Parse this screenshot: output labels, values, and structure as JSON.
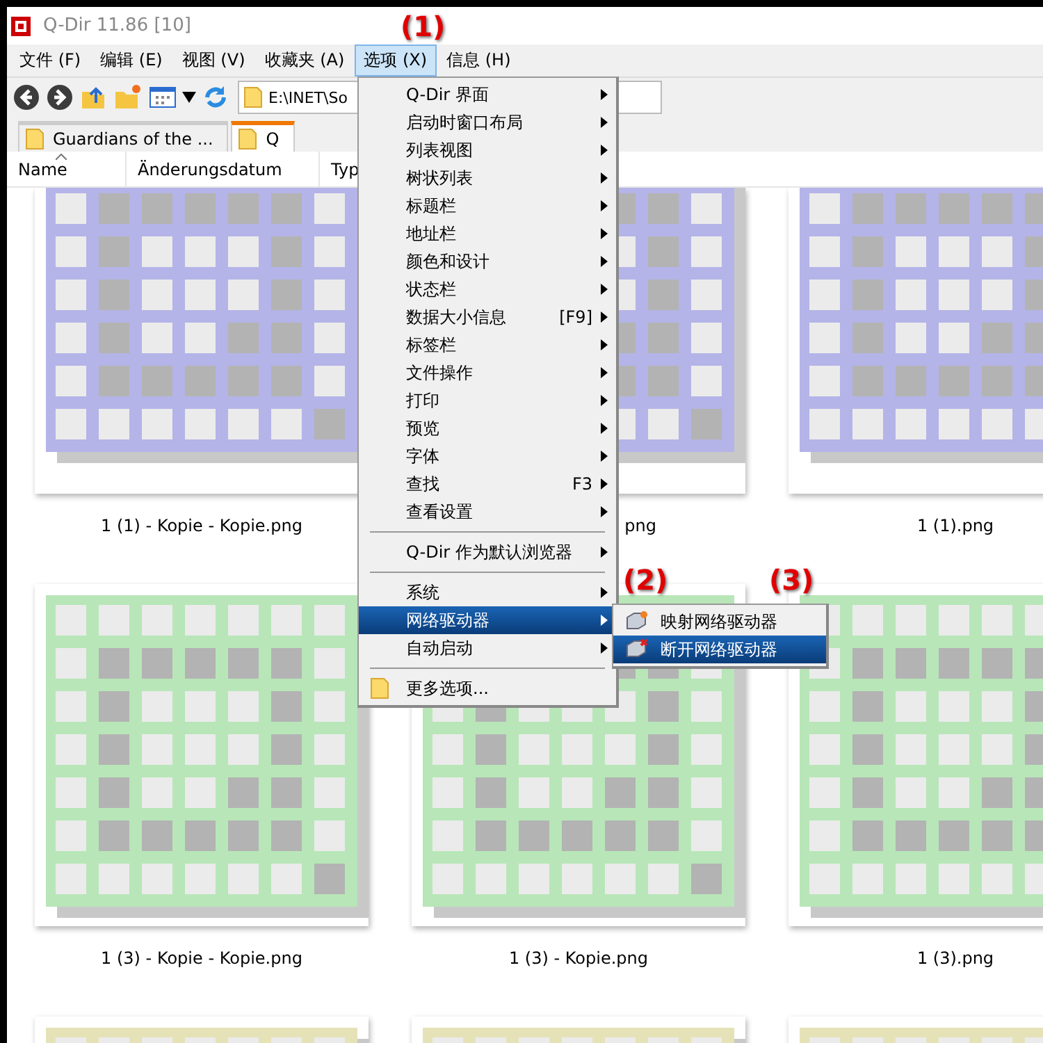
{
  "window": {
    "title": "Q-Dir 11.86 [10]"
  },
  "menubar": [
    {
      "label": "文件 (F)",
      "selected": false
    },
    {
      "label": "编辑 (E)",
      "selected": false
    },
    {
      "label": "视图 (V)",
      "selected": false
    },
    {
      "label": "收藏夹 (A)",
      "selected": false
    },
    {
      "label": "选项 (X)",
      "selected": true
    },
    {
      "label": "信息 (H)",
      "selected": false
    }
  ],
  "address": {
    "value": "E:\\INET\\So"
  },
  "tabs": [
    {
      "label": "Guardians of the ...",
      "selected": false
    },
    {
      "label": "Q",
      "selected": true
    }
  ],
  "columns": [
    "Name",
    "Änderungsdatum",
    "Typ"
  ],
  "files": [
    {
      "name": "1 (1) - Kopie - Kopie.png",
      "color": "#b4b4e8"
    },
    {
      "name": "png",
      "color": "#b4b4e8",
      "name_cut": true
    },
    {
      "name": "1 (1).png",
      "color": "#b4b4e8"
    },
    {
      "name": "1 (3) - Kopie - Kopie.png",
      "color": "#b8e6b8"
    },
    {
      "name": "1 (3) - Kopie.png",
      "color": "#b8e6b8"
    },
    {
      "name": "1 (3).png",
      "color": "#b8e6b8"
    },
    {
      "color": "#e6e2b8"
    },
    {
      "color": "#e6e2b8"
    },
    {
      "color": "#e6e2b8"
    }
  ],
  "menu": [
    {
      "kind": "item",
      "label": "Q-Dir 界面",
      "submenu": true,
      "selected": false
    },
    {
      "kind": "item",
      "label": "启动时窗口布局",
      "submenu": true,
      "selected": false
    },
    {
      "kind": "item",
      "label": "列表视图",
      "submenu": true,
      "selected": false
    },
    {
      "kind": "item",
      "label": "树状列表",
      "submenu": true,
      "selected": false
    },
    {
      "kind": "item",
      "label": "标题栏",
      "submenu": true,
      "selected": false
    },
    {
      "kind": "item",
      "label": "地址栏",
      "submenu": true,
      "selected": false
    },
    {
      "kind": "item",
      "label": "颜色和设计",
      "submenu": true,
      "selected": false
    },
    {
      "kind": "item",
      "label": "状态栏",
      "submenu": true,
      "selected": false
    },
    {
      "kind": "item",
      "label": "数据大小信息",
      "shortcut": "[F9]",
      "submenu": true,
      "selected": false
    },
    {
      "kind": "item",
      "label": "标签栏",
      "submenu": true,
      "selected": false
    },
    {
      "kind": "item",
      "label": "文件操作",
      "submenu": true,
      "selected": false
    },
    {
      "kind": "item",
      "label": "打印",
      "submenu": true,
      "selected": false
    },
    {
      "kind": "item",
      "label": "预览",
      "submenu": true,
      "selected": false
    },
    {
      "kind": "item",
      "label": "字体",
      "submenu": true,
      "selected": false
    },
    {
      "kind": "item",
      "label": "查找",
      "shortcut": "F3",
      "submenu": true,
      "selected": false
    },
    {
      "kind": "item",
      "label": "查看设置",
      "submenu": true,
      "selected": false
    },
    {
      "kind": "separator"
    },
    {
      "kind": "item",
      "label": "Q-Dir 作为默认浏览器",
      "submenu": true,
      "selected": false
    },
    {
      "kind": "separator"
    },
    {
      "kind": "item",
      "label": "系统",
      "submenu": true,
      "selected": false
    },
    {
      "kind": "item",
      "label": "网络驱动器",
      "submenu": true,
      "selected": true
    },
    {
      "kind": "item",
      "label": "自动启动",
      "submenu": true,
      "selected": false
    },
    {
      "kind": "separator"
    },
    {
      "kind": "folder",
      "label": "更多选项...",
      "submenu": false,
      "selected": false
    }
  ],
  "submenu": [
    {
      "label": "映射网络驱动器",
      "selected": false
    },
    {
      "label": "断开网络驱动器",
      "selected": true
    }
  ],
  "annotations": [
    "(1)",
    "(2)",
    "(3)"
  ]
}
